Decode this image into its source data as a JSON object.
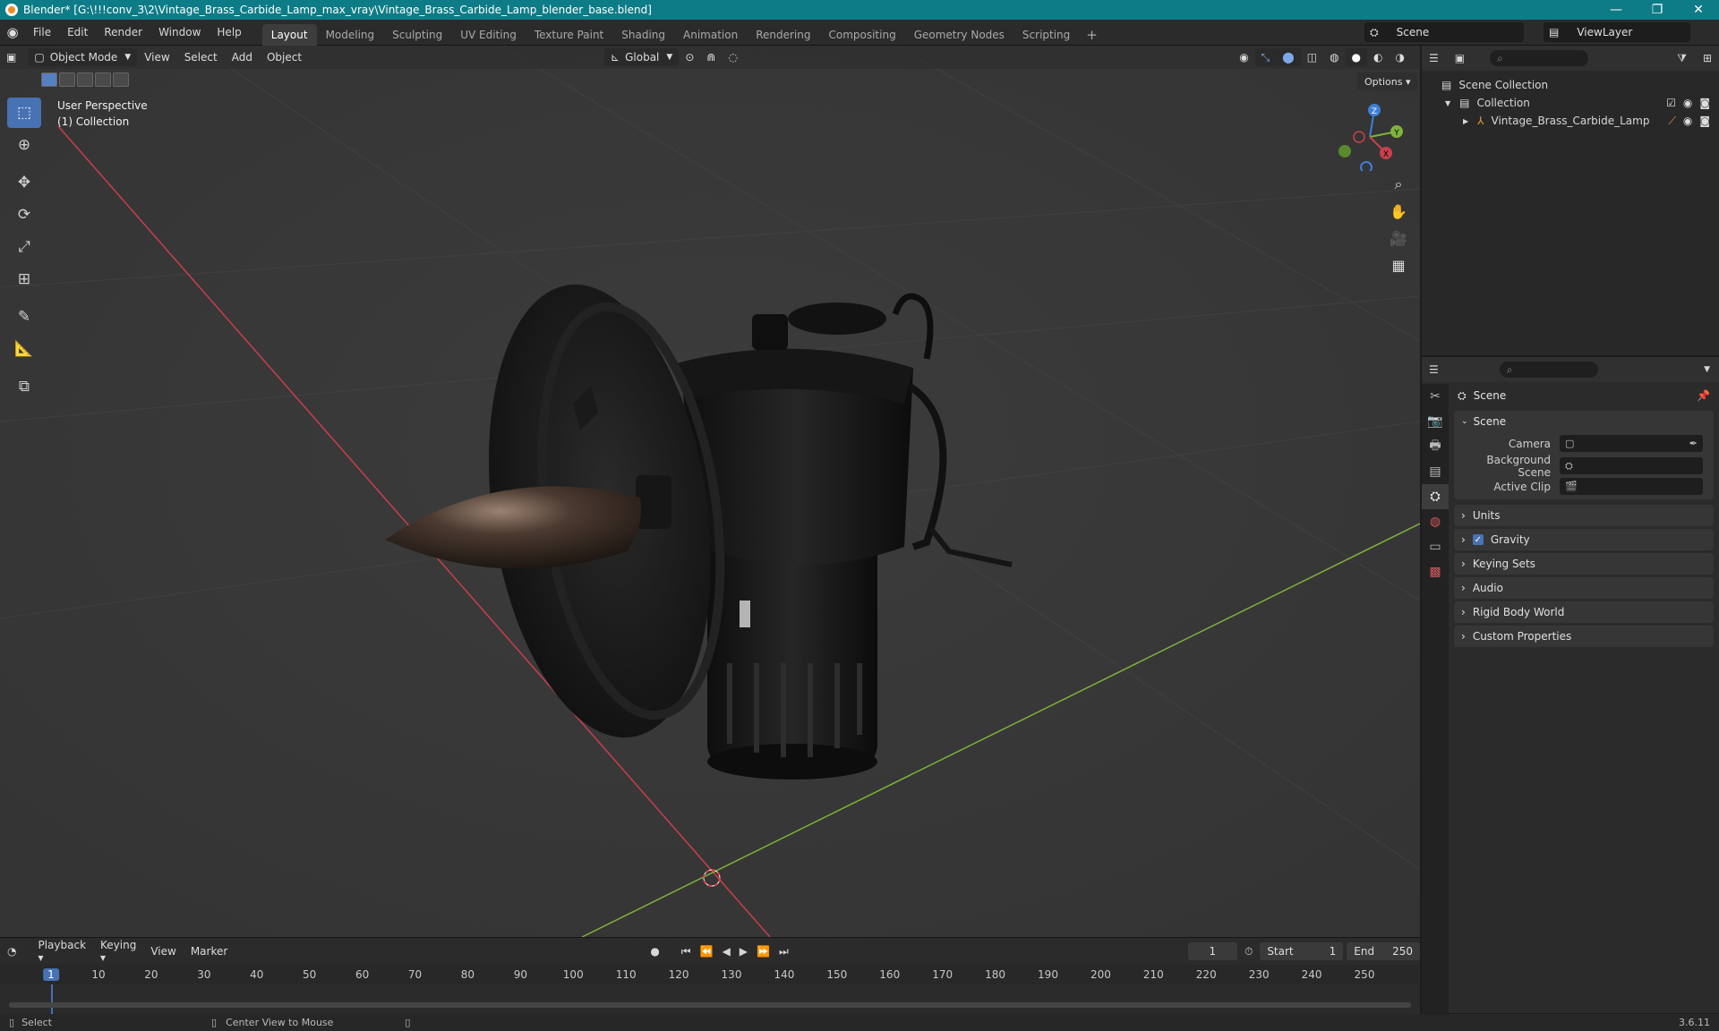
{
  "titlebar": {
    "title": "Blender* [G:\\!!!conv_3\\2\\Vintage_Brass_Carbide_Lamp_max_vray\\Vintage_Brass_Carbide_Lamp_blender_base.blend]",
    "minimize": "—",
    "restore": "❐",
    "close": "✕"
  },
  "menu": [
    "File",
    "Edit",
    "Render",
    "Window",
    "Help"
  ],
  "workspaces": [
    "Layout",
    "Modeling",
    "Sculpting",
    "UV Editing",
    "Texture Paint",
    "Shading",
    "Animation",
    "Rendering",
    "Compositing",
    "Geometry Nodes",
    "Scripting"
  ],
  "workspace_add": "+",
  "scene_name": "Scene",
  "view_layer": "ViewLayer",
  "viewport": {
    "mode": "Object Mode",
    "menus": [
      "View",
      "Select",
      "Add",
      "Object"
    ],
    "transform_orientation": "Global",
    "options": "Options",
    "overlay_line1": "User Perspective",
    "overlay_line2": "(1) Collection",
    "gizmo": {
      "z": "Z",
      "y": "Y",
      "x": "X"
    }
  },
  "outliner": {
    "scene_collection": "Scene Collection",
    "collection": "Collection",
    "object": "Vintage_Brass_Carbide_Lamp"
  },
  "properties": {
    "scene_header": "Scene",
    "panel_scene": "Scene",
    "camera_label": "Camera",
    "background_label": "Background Scene",
    "clip_label": "Active Clip",
    "subpanels": [
      "Units",
      "Gravity",
      "Keying Sets",
      "Audio",
      "Rigid Body World",
      "Custom Properties"
    ]
  },
  "timeline": {
    "menus": [
      "Playback",
      "Keying",
      "View",
      "Marker"
    ],
    "current_frame": "1",
    "start_label": "Start",
    "start": "1",
    "end_label": "End",
    "end": "250",
    "ticks": [
      "1",
      "10",
      "20",
      "30",
      "40",
      "50",
      "60",
      "70",
      "80",
      "90",
      "100",
      "110",
      "120",
      "130",
      "140",
      "150",
      "160",
      "170",
      "180",
      "190",
      "200",
      "210",
      "220",
      "230",
      "240",
      "250"
    ]
  },
  "status": {
    "select": "Select",
    "center": "Center View to Mouse",
    "version": "3.6.11"
  },
  "colors": {
    "accent": "#4772b3",
    "titlebar": "#0e7c86",
    "x_axis": "#c93f4c",
    "y_axis": "#7fb33a",
    "z_axis": "#3f7fd9"
  }
}
